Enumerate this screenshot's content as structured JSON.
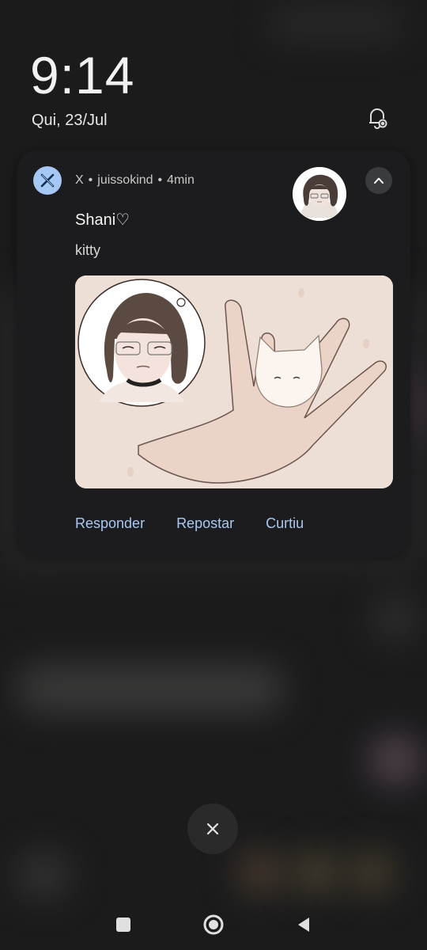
{
  "lockscreen": {
    "time": "9:14",
    "date": "Qui, 23/Jul"
  },
  "notification": {
    "app_name": "X",
    "account": "juissokind",
    "age": "4min",
    "title": "Shani♡",
    "text": "kitty",
    "actions": [
      {
        "label": "Responder"
      },
      {
        "label": "Repostar"
      },
      {
        "label": "Curtiu"
      }
    ]
  },
  "icons": {
    "app": "x-logo-icon",
    "bell": "notification-settings-icon",
    "collapse": "chevron-up-icon",
    "dismiss": "close-icon",
    "nav": [
      "recents-icon",
      "home-icon",
      "back-icon"
    ]
  },
  "colors": {
    "card_bg": "#1c1c1e",
    "action_text": "#a9c9f2",
    "app_icon_bg": "#a6c8f5"
  }
}
